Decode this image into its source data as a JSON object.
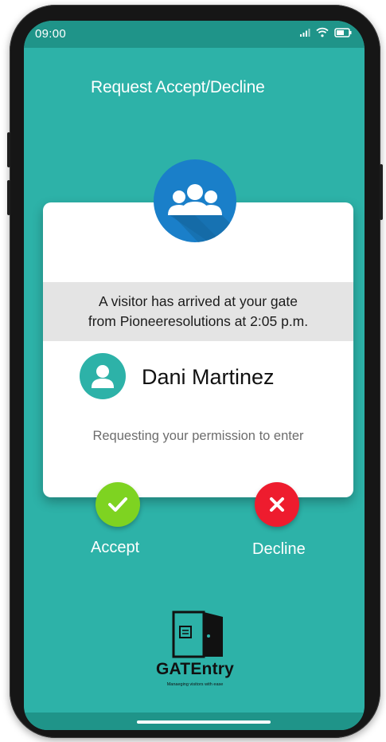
{
  "status_bar": {
    "time": "09:00",
    "icons": [
      "signal-icon",
      "wifi-icon",
      "battery-icon"
    ]
  },
  "header": {
    "title": "Request Accept/Decline"
  },
  "card": {
    "badge_icon": "group-users-icon",
    "notice_line1": "A visitor has arrived at your gate",
    "notice_line2": "from Pioneeresolutions at 2:05 p.m.",
    "visitor_name": "Dani Martinez",
    "avatar_icon": "person-avatar-icon",
    "request_text": "Requesting your permission to enter"
  },
  "actions": {
    "accept_label": "Accept",
    "decline_label": "Decline",
    "accept_icon": "checkmark-icon",
    "decline_icon": "close-icon"
  },
  "brand": {
    "logo_icon": "door-logo-icon",
    "name": "GATEntry",
    "tagline": "Manaeging visitors with ease"
  },
  "colors": {
    "screen_bg": "#2db2a8",
    "status_bar": "#1f9489",
    "badge_blue": "#1a7fc9",
    "accept_green": "#7ed321",
    "decline_red": "#ee1c2e"
  }
}
